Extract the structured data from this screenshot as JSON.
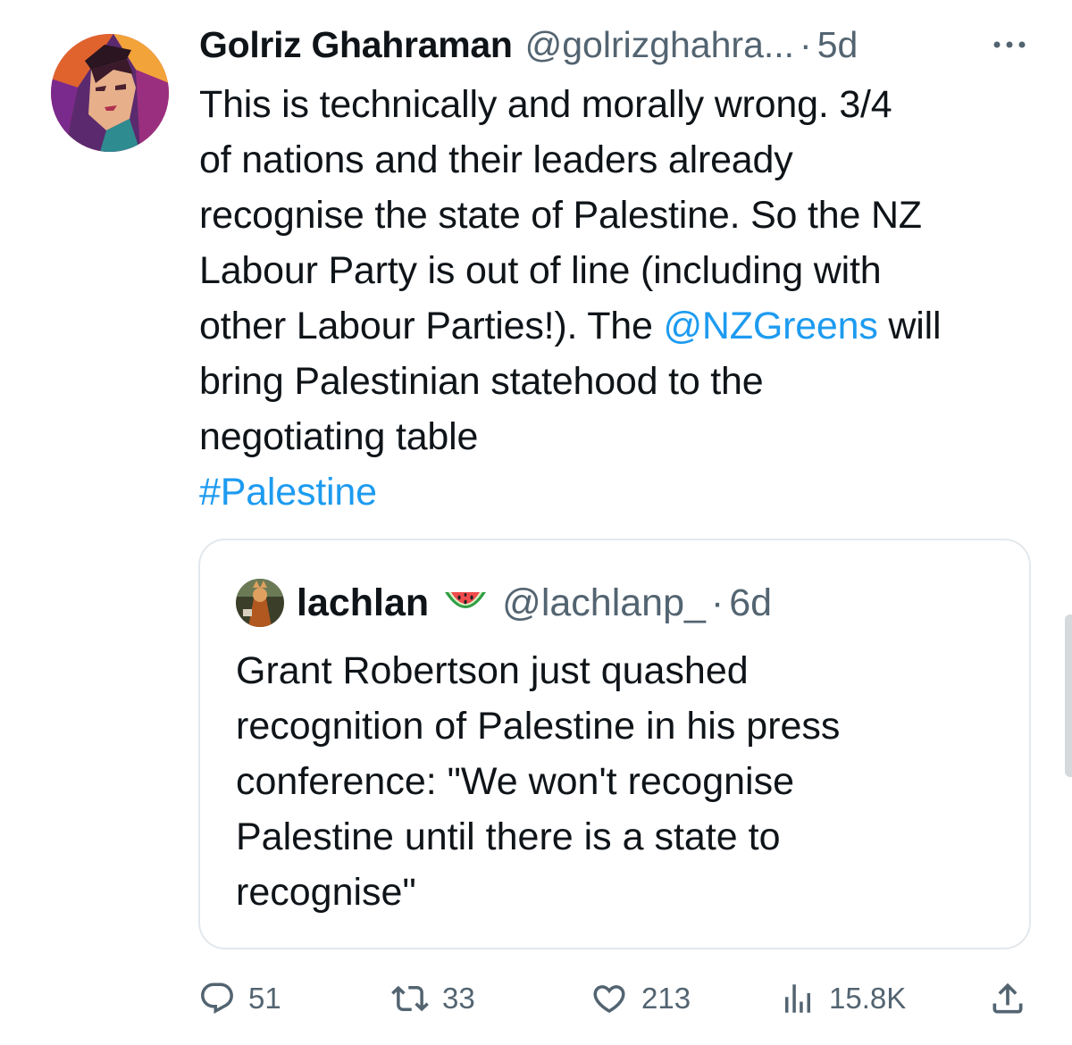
{
  "tweet": {
    "author": {
      "display_name": "Golriz Ghahraman",
      "handle": "@golrizghahra...",
      "separator": "·",
      "time": "5d"
    },
    "text_lines": [
      "This is technically and morally wrong. 3/4",
      "of nations and their leaders already",
      "recognise the state of Palestine. So the NZ",
      "Labour Party is out of line (including with"
    ],
    "line5_pre": "other Labour Parties!). The ",
    "mention": "@NZGreens",
    "line5_post": " will",
    "line6": "bring Palestinian statehood to the",
    "line7": "negotiating table",
    "hashtag": "#Palestine",
    "more_icon": "more-horizontal-icon"
  },
  "quote": {
    "display_name": "lachlan",
    "emoji_icon": "watermelon-icon",
    "handle": "@lachlanp_",
    "separator": "·",
    "time": "6d",
    "text_lines": [
      "Grant Robertson just quashed",
      "recognition of Palestine in his press",
      "conference: \"We won't recognise",
      "Palestine until there is a state to",
      "recognise\""
    ]
  },
  "actions": {
    "reply": {
      "icon": "reply-icon",
      "count": "51"
    },
    "retweet": {
      "icon": "retweet-icon",
      "count": "33"
    },
    "like": {
      "icon": "heart-icon",
      "count": "213"
    },
    "views": {
      "icon": "views-icon",
      "count": "15.8K"
    },
    "share": {
      "icon": "share-icon"
    }
  },
  "colors": {
    "text": "#0f1419",
    "secondary": "#536471",
    "link": "#1d9bf0",
    "border": "#e3e8ec"
  }
}
